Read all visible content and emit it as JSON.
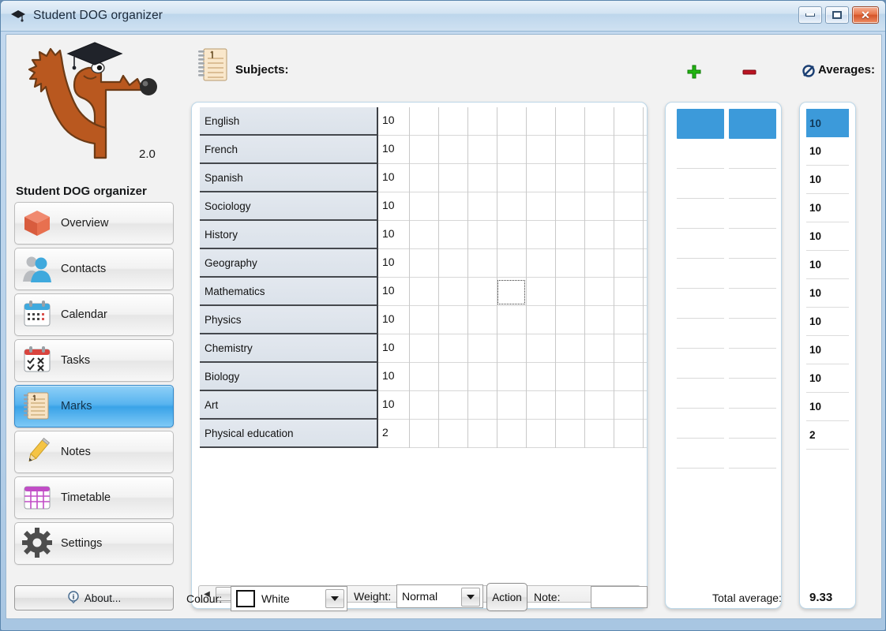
{
  "window": {
    "title": "Student DOG organizer",
    "title_icon": "graduation-cap-icon",
    "minimize_label": "–",
    "maximize_label": "□",
    "close_label": "✕"
  },
  "sidebar": {
    "version": "2.0",
    "app_name": "Student DOG organizer",
    "logo_icon": "dog-graduate-logo",
    "items": [
      {
        "label": "Overview",
        "icon": "cube-icon",
        "active": false
      },
      {
        "label": "Contacts",
        "icon": "people-icon",
        "active": false
      },
      {
        "label": "Calendar",
        "icon": "calendar-icon",
        "active": false
      },
      {
        "label": "Tasks",
        "icon": "checklist-icon",
        "active": false
      },
      {
        "label": "Marks",
        "icon": "notebook-icon",
        "active": true
      },
      {
        "label": "Notes",
        "icon": "pencil-icon",
        "active": false
      },
      {
        "label": "Timetable",
        "icon": "grid-icon",
        "active": false
      },
      {
        "label": "Settings",
        "icon": "gear-icon",
        "active": false
      }
    ],
    "about_label": "About...",
    "about_icon": "info-icon"
  },
  "header": {
    "subjects_label": "Subjects:",
    "subjects_icon": "notebook-icon",
    "add_icon": "plus-icon",
    "remove_icon": "minus-icon",
    "averages_label": "Averages:",
    "averages_icon": "average-icon"
  },
  "table": {
    "subjects": [
      "English",
      "French",
      "Spanish",
      "Sociology",
      "History",
      "Geography",
      "Mathematics",
      "Physics",
      "Chemistry",
      "Biology",
      "Art",
      "Physical education"
    ],
    "marks": [
      "10",
      "10",
      "10",
      "10",
      "10",
      "10",
      "10",
      "10",
      "10",
      "10",
      "10",
      "2"
    ],
    "averages": [
      "10",
      "10",
      "10",
      "10",
      "10",
      "10",
      "10",
      "10",
      "10",
      "10",
      "10",
      "2"
    ],
    "selected_average_index": 0,
    "grid_columns": 9,
    "cursor_cell": {
      "row": 6,
      "col": 3
    }
  },
  "scrollbar": {
    "left_arrow": "◀",
    "right_arrow": "▶"
  },
  "bottom": {
    "colour_label": "Colour:",
    "colour_value": "White",
    "colour_swatch": "#ffffff",
    "weight_label": "Weight:",
    "weight_value": "Normal",
    "action_label": "Action",
    "note_label": "Note:",
    "note_value": "",
    "total_label": "Total average:",
    "total_value": "9.33"
  },
  "colors": {
    "accent_blue": "#3c9ada",
    "plus_green": "#22b511",
    "minus_red": "#bb1422",
    "titlebar": "#cfe1f1"
  }
}
